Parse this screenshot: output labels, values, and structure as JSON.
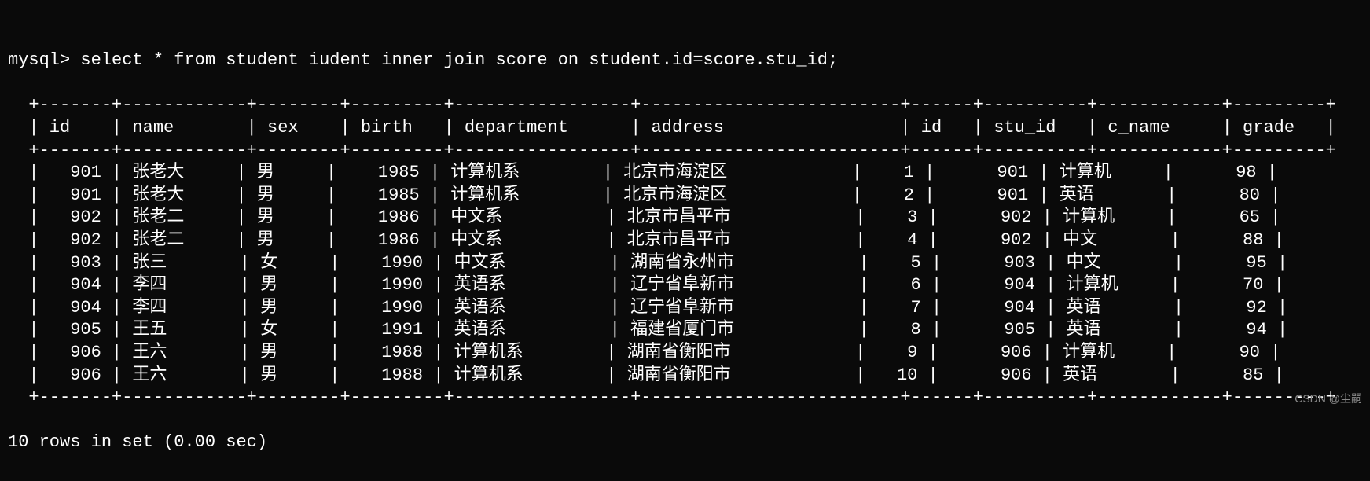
{
  "prompt": "mysql> ",
  "query": "select * from student iudent inner join score on student.id=score.stu_id;",
  "columns": [
    {
      "name": "id",
      "width": 5,
      "align": "right"
    },
    {
      "name": "name",
      "width": 10,
      "align": "left"
    },
    {
      "name": "sex",
      "width": 6,
      "align": "left"
    },
    {
      "name": "birth",
      "width": 7,
      "align": "right"
    },
    {
      "name": "department",
      "width": 15,
      "align": "left"
    },
    {
      "name": "address",
      "width": 23,
      "align": "left"
    },
    {
      "name": "id",
      "width": 4,
      "align": "right"
    },
    {
      "name": "stu_id",
      "width": 8,
      "align": "right"
    },
    {
      "name": "c_name",
      "width": 10,
      "align": "left"
    },
    {
      "name": "grade",
      "width": 7,
      "align": "right"
    }
  ],
  "rows": [
    [
      "901",
      "张老大",
      "男",
      "1985",
      "计算机系",
      "北京市海淀区",
      "1",
      "901",
      "计算机",
      "98"
    ],
    [
      "901",
      "张老大",
      "男",
      "1985",
      "计算机系",
      "北京市海淀区",
      "2",
      "901",
      "英语",
      "80"
    ],
    [
      "902",
      "张老二",
      "男",
      "1986",
      "中文系",
      "北京市昌平市",
      "3",
      "902",
      "计算机",
      "65"
    ],
    [
      "902",
      "张老二",
      "男",
      "1986",
      "中文系",
      "北京市昌平市",
      "4",
      "902",
      "中文",
      "88"
    ],
    [
      "903",
      "张三",
      "女",
      "1990",
      "中文系",
      "湖南省永州市",
      "5",
      "903",
      "中文",
      "95"
    ],
    [
      "904",
      "李四",
      "男",
      "1990",
      "英语系",
      "辽宁省阜新市",
      "6",
      "904",
      "计算机",
      "70"
    ],
    [
      "904",
      "李四",
      "男",
      "1990",
      "英语系",
      "辽宁省阜新市",
      "7",
      "904",
      "英语",
      "92"
    ],
    [
      "905",
      "王五",
      "女",
      "1991",
      "英语系",
      "福建省厦门市",
      "8",
      "905",
      "英语",
      "94"
    ],
    [
      "906",
      "王六",
      "男",
      "1988",
      "计算机系",
      "湖南省衡阳市",
      "9",
      "906",
      "计算机",
      "90"
    ],
    [
      "906",
      "王六",
      "男",
      "1988",
      "计算机系",
      "湖南省衡阳市",
      "10",
      "906",
      "英语",
      "85"
    ]
  ],
  "footer": "10 rows in set (0.00 sec)",
  "watermark": "CSDN @尘嗣"
}
